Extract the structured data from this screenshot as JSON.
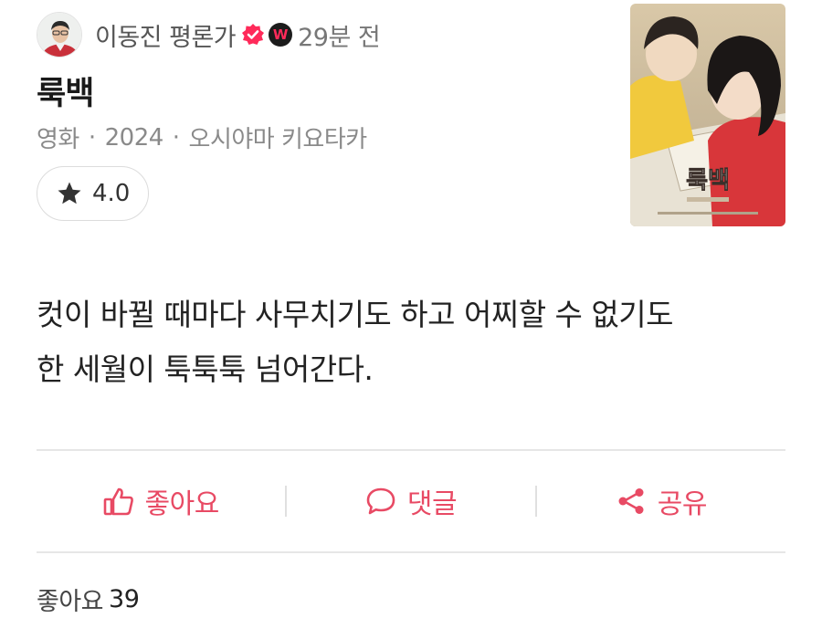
{
  "author": {
    "name": "이동진 평론가",
    "time_ago": "29분 전",
    "badge_letter": "W",
    "avatar_icon": "person-avatar",
    "verified_icon": "verified-badge-icon"
  },
  "content": {
    "title": "룩백",
    "meta": {
      "category": "영화",
      "separator": "·",
      "year": "2024",
      "director": "오시야마 키요타카"
    },
    "rating": {
      "icon": "star-icon",
      "value": "4.0"
    },
    "poster": {
      "title_text": "룩백",
      "alt": "movie poster"
    },
    "review_lines": [
      "컷이 바뀔 때마다 사무치기도 하고 어찌할 수 없기도",
      "한 세월이 툭툭툭 넘어간다."
    ]
  },
  "actions": {
    "like_label": "좋아요",
    "comment_label": "댓글",
    "share_label": "공유"
  },
  "footer": {
    "like_label": "좋아요",
    "like_count": "39"
  },
  "colors": {
    "accent": "#e84a64",
    "badge": "#ff2a5a"
  }
}
